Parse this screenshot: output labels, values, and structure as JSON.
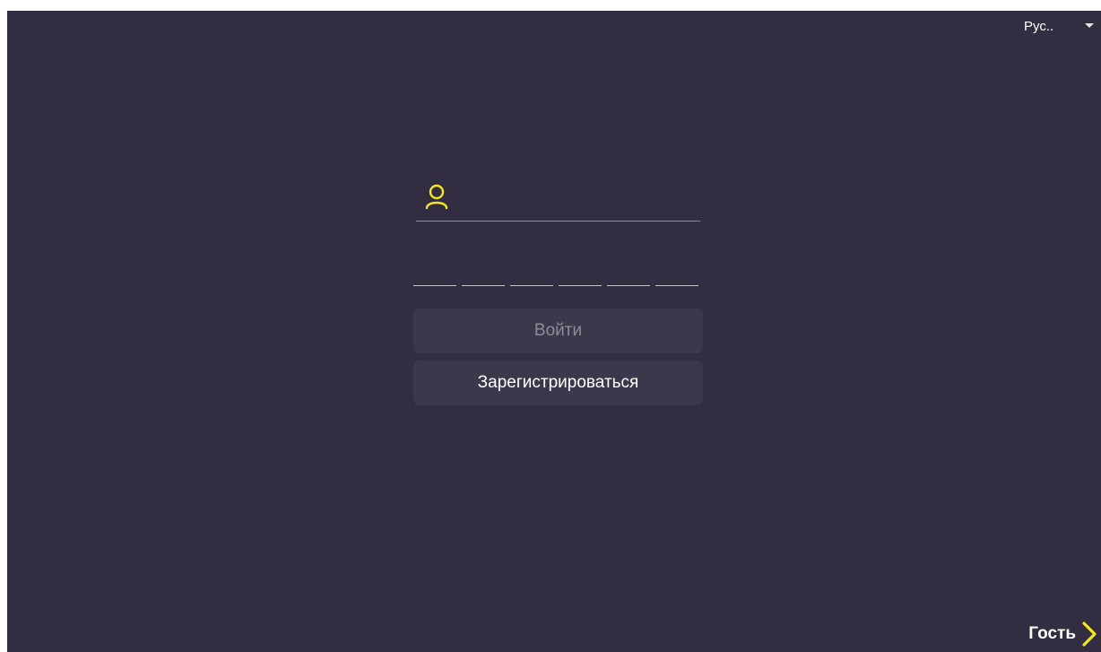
{
  "language": {
    "selected": "Рус..",
    "caret_icon": "caret-down-icon"
  },
  "login_form": {
    "user_icon": "user-icon",
    "user_input_value": "",
    "pin_cells": [
      "",
      "",
      "",
      "",
      "",
      ""
    ],
    "login_label": "Войти",
    "register_label": "Зарегистрироваться"
  },
  "guest": {
    "label": "Гость",
    "icon": "chevron-right-icon"
  },
  "colors": {
    "background": "#322d41",
    "accent": "#f5e61e",
    "button_bg": "#3c374b",
    "disabled_text": "#8f8b98"
  }
}
